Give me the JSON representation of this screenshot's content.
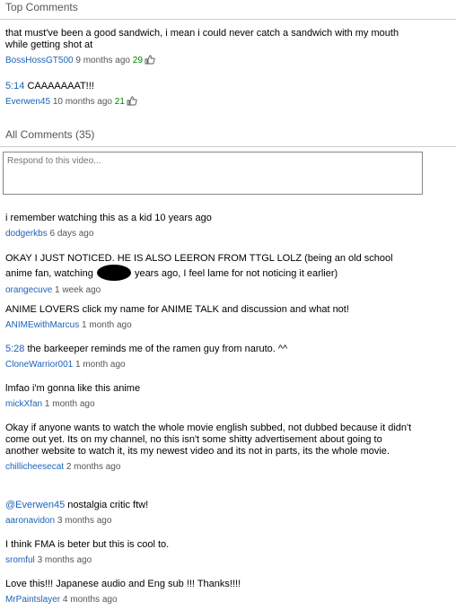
{
  "top_comments": {
    "title": "Top Comments",
    "items": [
      {
        "text": "that must've been a good sandwich, i mean i could never catch a sandwich with my mouth while getting shot at",
        "user": "BossHossGT500",
        "time": "9 months ago",
        "likes": "29"
      },
      {
        "timestamp_link": "5:14",
        "text": " CAAAAAAAT!!!",
        "user": "Everwen45",
        "time": "10 months ago",
        "likes": "21"
      }
    ]
  },
  "all_comments": {
    "title": "All Comments (35)",
    "reply_placeholder": "Respond to this video...",
    "items": [
      {
        "text": "i remember watching this as a kid 10 years ago",
        "user": "dodgerkbs",
        "time": "6 days ago"
      },
      {
        "text_before": "OKAY I JUST NOTICED. HE IS ALSO LEERON FROM TTGL LOLZ (being an old school anime fan, watching ",
        "text_after": " years ago, I feel lame for not noticing it earlier)",
        "user": "orangecuve",
        "time": "1 week ago"
      },
      {
        "text": "ANIME LOVERS click my name for ANIME TALK and discussion and what not!",
        "user": "ANIMEwithMarcus",
        "time": "1 month ago"
      },
      {
        "timestamp_link": "5:28",
        "text": " the barkeeper reminds me of the ramen guy from naruto. ^^",
        "user": "CloneWarrior001",
        "time": "1 month ago"
      },
      {
        "text": "lmfao i'm gonna like this anime",
        "user": "mickXfan",
        "time": "1 month ago"
      },
      {
        "text": "Okay if anyone wants to watch the whole movie english subbed, not dubbed because it didn't come out yet. Its on my channel, no this isn't some shitty advertisement about going to another website to watch it, its my newest video and its not in parts, its the whole movie.",
        "user": "chillicheesecat",
        "time": "2 months ago"
      },
      {
        "mention_link": "@Everwen45",
        "text": " nostalgia critic ftw!",
        "user": "aaronavidon",
        "time": "3 months ago"
      },
      {
        "text": "I think FMA is beter but this is cool to.",
        "user": "sromful",
        "time": "3 months ago"
      },
      {
        "text": "Love this!!! Japanese audio and Eng sub !!! Thanks!!!!",
        "user": "MrPaintslayer",
        "time": "4 months ago"
      }
    ]
  },
  "icons": {
    "thumb": "thumbs-up-icon",
    "redaction": "redaction-mark"
  },
  "colors": {
    "link": "#1c62b9",
    "likes": "#008000",
    "meta": "#555555"
  }
}
